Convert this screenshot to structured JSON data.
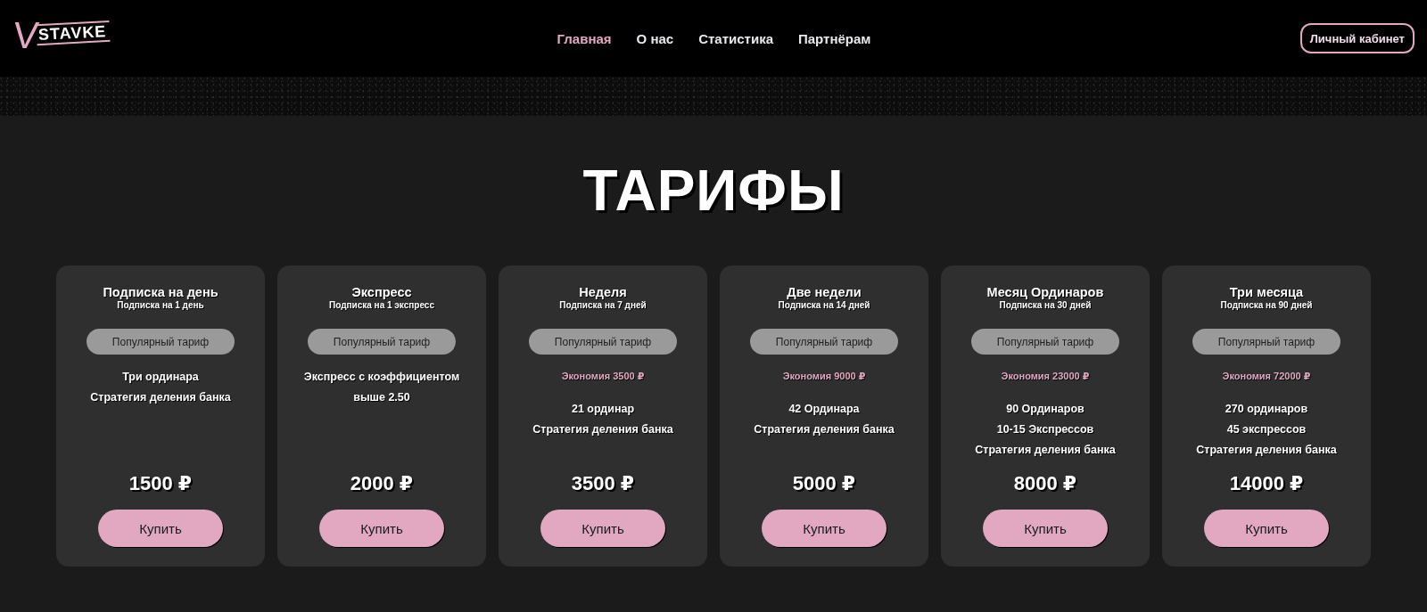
{
  "header": {
    "logo": {
      "mark": "V",
      "text": "STAVKE"
    },
    "nav": [
      {
        "label": "Главная",
        "selected": true
      },
      {
        "label": "О нас",
        "selected": false
      },
      {
        "label": "Статистика",
        "selected": false
      },
      {
        "label": "Партнёрам",
        "selected": false
      }
    ],
    "account_button": "Личный кабинет"
  },
  "pricing": {
    "title": "ТАРИФЫ",
    "plans": [
      {
        "title": "Подписка на день",
        "subtitle": "Подписка на 1 день",
        "badge": "Популярный тариф",
        "features": [
          "Три ординара",
          "Стратегия деления банка"
        ],
        "price": "1500 ₽",
        "button": "Купить"
      },
      {
        "title": "Экспресс",
        "subtitle": "Подписка на 1 экспресс",
        "badge": "Популярный тариф",
        "features": [
          "Экспресс с коэффициентом выше 2.50"
        ],
        "price": "2000 ₽",
        "button": "Купить"
      },
      {
        "title": "Неделя",
        "subtitle": "Подписка на 7 дней",
        "badge": "Популярный тариф",
        "savings": "Экономия 3500 ₽",
        "features": [
          "21 ординар",
          "Стратегия деления банка"
        ],
        "price": "3500 ₽",
        "button": "Купить"
      },
      {
        "title": "Две недели",
        "subtitle": "Подписка на 14 дней",
        "badge": "Популярный тариф",
        "savings": "Экономия 9000 ₽",
        "features": [
          "42 Ординара",
          "Стратегия деления банка"
        ],
        "price": "5000 ₽",
        "button": "Купить"
      },
      {
        "title": "Месяц Ординаров",
        "subtitle": "Подписка на 30 дней",
        "badge": "Популярный тариф",
        "savings": "Экономия 23000 ₽",
        "features": [
          "90 Ординаров",
          "10-15 Экспрессов",
          "Стратегия деления банка"
        ],
        "price": "8000 ₽",
        "button": "Купить"
      },
      {
        "title": "Три месяца",
        "subtitle": "Подписка на 90 дней",
        "badge": "Популярный тариф",
        "savings": "Экономия 72000 ₽",
        "features": [
          "270 ординаров",
          "45 экспрессов",
          "Стратегия деления банка"
        ],
        "price": "14000 ₽",
        "button": "Купить"
      }
    ]
  }
}
